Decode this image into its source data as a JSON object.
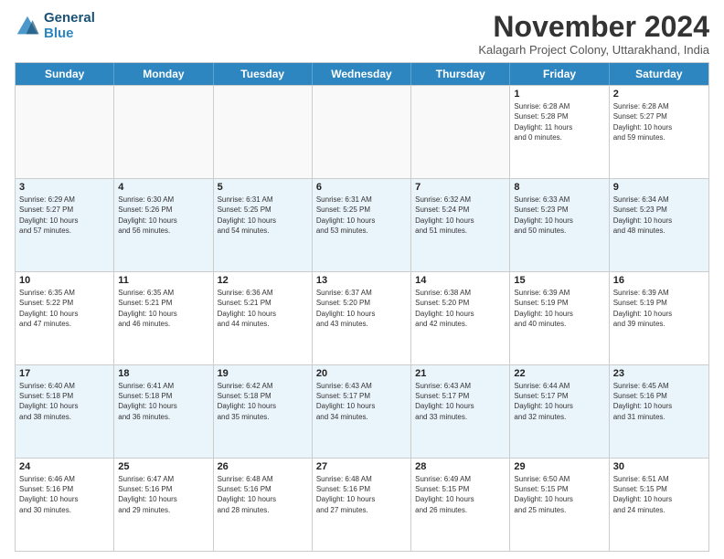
{
  "header": {
    "logo_line1": "General",
    "logo_line2": "Blue",
    "month_title": "November 2024",
    "subtitle": "Kalagarh Project Colony, Uttarakhand, India"
  },
  "weekdays": [
    "Sunday",
    "Monday",
    "Tuesday",
    "Wednesday",
    "Thursday",
    "Friday",
    "Saturday"
  ],
  "rows": [
    {
      "alt": false,
      "cells": [
        {
          "day": "",
          "info": "",
          "empty": true
        },
        {
          "day": "",
          "info": "",
          "empty": true
        },
        {
          "day": "",
          "info": "",
          "empty": true
        },
        {
          "day": "",
          "info": "",
          "empty": true
        },
        {
          "day": "",
          "info": "",
          "empty": true
        },
        {
          "day": "1",
          "info": "Sunrise: 6:28 AM\nSunset: 5:28 PM\nDaylight: 11 hours\nand 0 minutes.",
          "empty": false
        },
        {
          "day": "2",
          "info": "Sunrise: 6:28 AM\nSunset: 5:27 PM\nDaylight: 10 hours\nand 59 minutes.",
          "empty": false
        }
      ]
    },
    {
      "alt": true,
      "cells": [
        {
          "day": "3",
          "info": "Sunrise: 6:29 AM\nSunset: 5:27 PM\nDaylight: 10 hours\nand 57 minutes.",
          "empty": false
        },
        {
          "day": "4",
          "info": "Sunrise: 6:30 AM\nSunset: 5:26 PM\nDaylight: 10 hours\nand 56 minutes.",
          "empty": false
        },
        {
          "day": "5",
          "info": "Sunrise: 6:31 AM\nSunset: 5:25 PM\nDaylight: 10 hours\nand 54 minutes.",
          "empty": false
        },
        {
          "day": "6",
          "info": "Sunrise: 6:31 AM\nSunset: 5:25 PM\nDaylight: 10 hours\nand 53 minutes.",
          "empty": false
        },
        {
          "day": "7",
          "info": "Sunrise: 6:32 AM\nSunset: 5:24 PM\nDaylight: 10 hours\nand 51 minutes.",
          "empty": false
        },
        {
          "day": "8",
          "info": "Sunrise: 6:33 AM\nSunset: 5:23 PM\nDaylight: 10 hours\nand 50 minutes.",
          "empty": false
        },
        {
          "day": "9",
          "info": "Sunrise: 6:34 AM\nSunset: 5:23 PM\nDaylight: 10 hours\nand 48 minutes.",
          "empty": false
        }
      ]
    },
    {
      "alt": false,
      "cells": [
        {
          "day": "10",
          "info": "Sunrise: 6:35 AM\nSunset: 5:22 PM\nDaylight: 10 hours\nand 47 minutes.",
          "empty": false
        },
        {
          "day": "11",
          "info": "Sunrise: 6:35 AM\nSunset: 5:21 PM\nDaylight: 10 hours\nand 46 minutes.",
          "empty": false
        },
        {
          "day": "12",
          "info": "Sunrise: 6:36 AM\nSunset: 5:21 PM\nDaylight: 10 hours\nand 44 minutes.",
          "empty": false
        },
        {
          "day": "13",
          "info": "Sunrise: 6:37 AM\nSunset: 5:20 PM\nDaylight: 10 hours\nand 43 minutes.",
          "empty": false
        },
        {
          "day": "14",
          "info": "Sunrise: 6:38 AM\nSunset: 5:20 PM\nDaylight: 10 hours\nand 42 minutes.",
          "empty": false
        },
        {
          "day": "15",
          "info": "Sunrise: 6:39 AM\nSunset: 5:19 PM\nDaylight: 10 hours\nand 40 minutes.",
          "empty": false
        },
        {
          "day": "16",
          "info": "Sunrise: 6:39 AM\nSunset: 5:19 PM\nDaylight: 10 hours\nand 39 minutes.",
          "empty": false
        }
      ]
    },
    {
      "alt": true,
      "cells": [
        {
          "day": "17",
          "info": "Sunrise: 6:40 AM\nSunset: 5:18 PM\nDaylight: 10 hours\nand 38 minutes.",
          "empty": false
        },
        {
          "day": "18",
          "info": "Sunrise: 6:41 AM\nSunset: 5:18 PM\nDaylight: 10 hours\nand 36 minutes.",
          "empty": false
        },
        {
          "day": "19",
          "info": "Sunrise: 6:42 AM\nSunset: 5:18 PM\nDaylight: 10 hours\nand 35 minutes.",
          "empty": false
        },
        {
          "day": "20",
          "info": "Sunrise: 6:43 AM\nSunset: 5:17 PM\nDaylight: 10 hours\nand 34 minutes.",
          "empty": false
        },
        {
          "day": "21",
          "info": "Sunrise: 6:43 AM\nSunset: 5:17 PM\nDaylight: 10 hours\nand 33 minutes.",
          "empty": false
        },
        {
          "day": "22",
          "info": "Sunrise: 6:44 AM\nSunset: 5:17 PM\nDaylight: 10 hours\nand 32 minutes.",
          "empty": false
        },
        {
          "day": "23",
          "info": "Sunrise: 6:45 AM\nSunset: 5:16 PM\nDaylight: 10 hours\nand 31 minutes.",
          "empty": false
        }
      ]
    },
    {
      "alt": false,
      "cells": [
        {
          "day": "24",
          "info": "Sunrise: 6:46 AM\nSunset: 5:16 PM\nDaylight: 10 hours\nand 30 minutes.",
          "empty": false
        },
        {
          "day": "25",
          "info": "Sunrise: 6:47 AM\nSunset: 5:16 PM\nDaylight: 10 hours\nand 29 minutes.",
          "empty": false
        },
        {
          "day": "26",
          "info": "Sunrise: 6:48 AM\nSunset: 5:16 PM\nDaylight: 10 hours\nand 28 minutes.",
          "empty": false
        },
        {
          "day": "27",
          "info": "Sunrise: 6:48 AM\nSunset: 5:16 PM\nDaylight: 10 hours\nand 27 minutes.",
          "empty": false
        },
        {
          "day": "28",
          "info": "Sunrise: 6:49 AM\nSunset: 5:15 PM\nDaylight: 10 hours\nand 26 minutes.",
          "empty": false
        },
        {
          "day": "29",
          "info": "Sunrise: 6:50 AM\nSunset: 5:15 PM\nDaylight: 10 hours\nand 25 minutes.",
          "empty": false
        },
        {
          "day": "30",
          "info": "Sunrise: 6:51 AM\nSunset: 5:15 PM\nDaylight: 10 hours\nand 24 minutes.",
          "empty": false
        }
      ]
    }
  ]
}
